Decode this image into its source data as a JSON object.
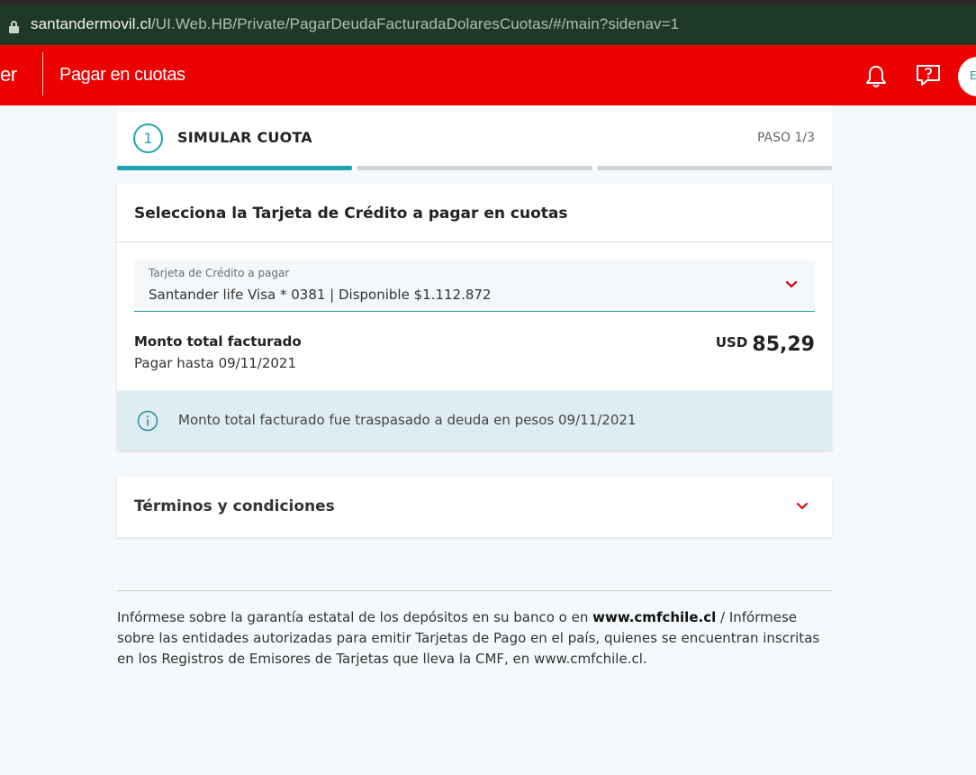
{
  "browser": {
    "url_host": "santandermovil.cl",
    "url_path": "/UI.Web.HB/Private/PagarDeudaFacturadaDolaresCuotas/#/main?sidenav=1"
  },
  "header": {
    "brand_tail": "er",
    "title": "Pagar en cuotas",
    "avatar_initial": "E"
  },
  "stepper": {
    "number": "1",
    "title": "SIMULAR CUOTA",
    "count": "PASO 1/3",
    "progress_current": 1,
    "progress_total": 3
  },
  "card_select": {
    "title": "Selecciona la Tarjeta de Crédito a pagar en cuotas",
    "field_label": "Tarjeta de Crédito a pagar",
    "field_value": "Santander life Visa * 0381 | Disponible $1.112.872",
    "monto_label": "Monto total facturado",
    "monto_date": "Pagar hasta 09/11/2021",
    "currency": "USD",
    "amount": "85,29",
    "info_message": "Monto total facturado fue traspasado a deuda en pesos 09/11/2021"
  },
  "terms": {
    "title": "Términos y condiciones"
  },
  "footer": {
    "text_1": "Infórmese sobre la garantía estatal de los depósitos en su banco o en ",
    "link": "www.cmfchile.cl",
    "text_2": " / Infórmese sobre las entidades autorizadas para emitir Tarjetas de Pago en el país, quienes se encuentran inscritas en los Registros de Emisores de Tarjetas que lleva la CMF, en www.cmfchile.cl."
  },
  "colors": {
    "brand_red": "#ec0000",
    "accent_teal": "#1fa3b1",
    "info_bg": "#deedf2"
  }
}
